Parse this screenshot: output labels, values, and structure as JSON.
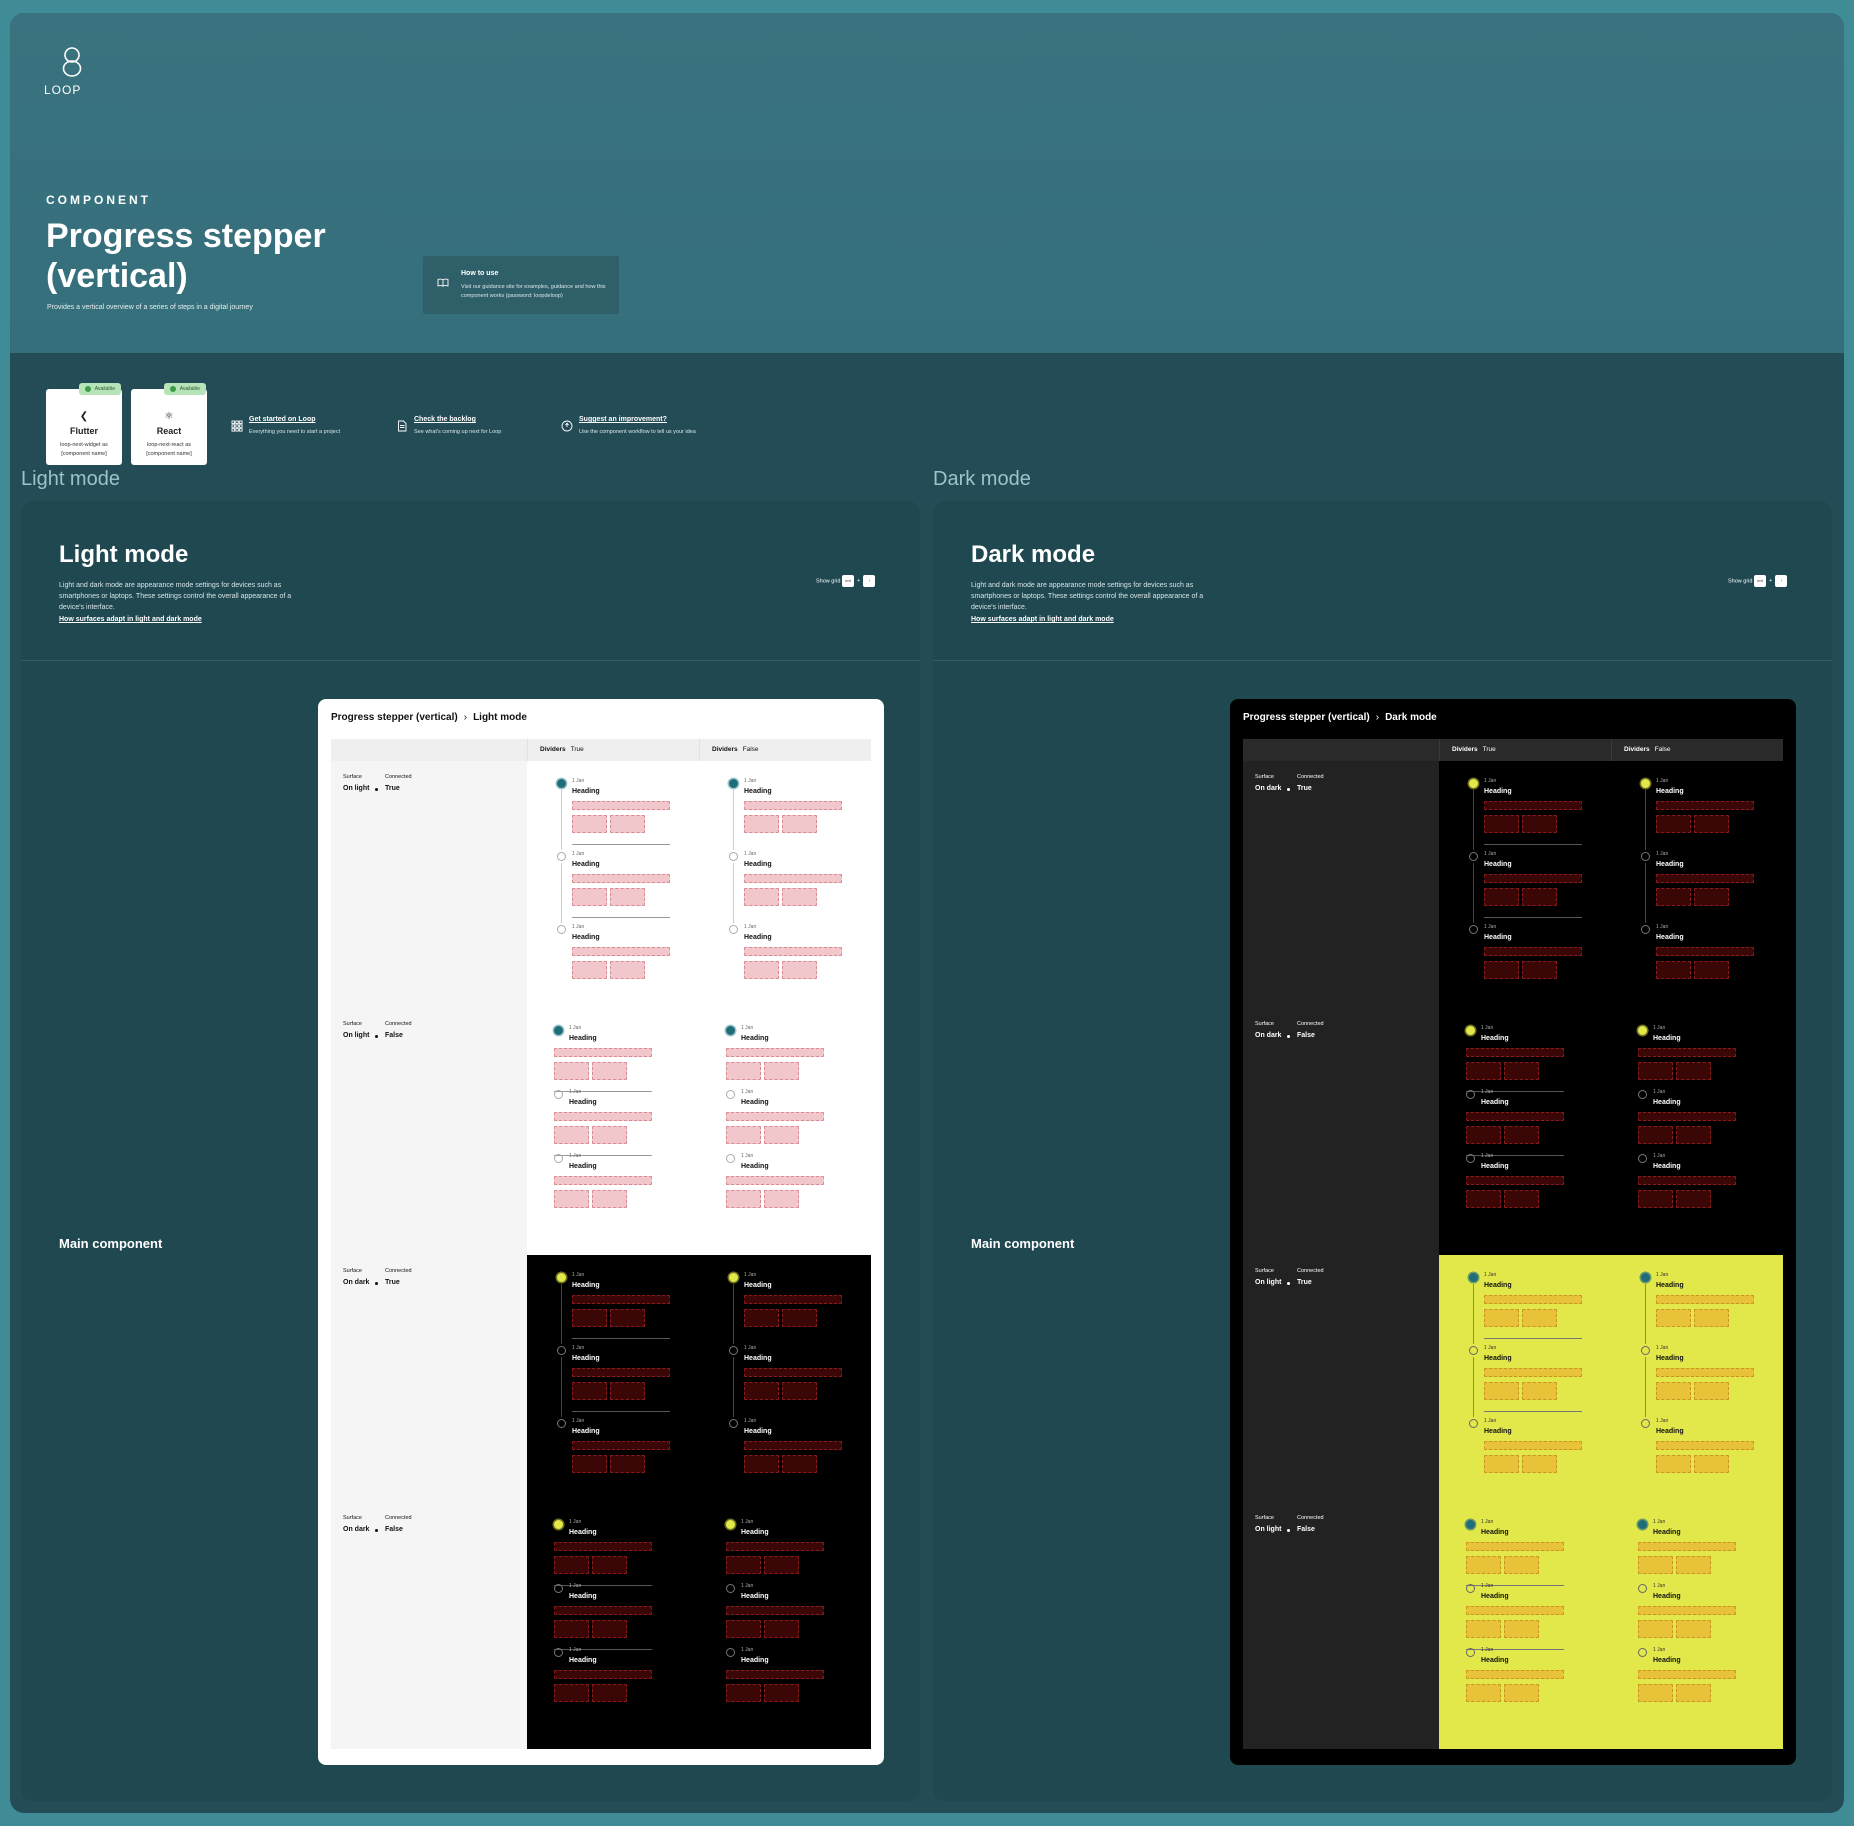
{
  "brand": {
    "wordmark": "LOOP"
  },
  "hero": {
    "kicker": "COMPONENT",
    "title": "Progress stepper (vertical)",
    "subtitle": "Provides a vertical overview of a series of steps in a digital journey",
    "howto": {
      "title": "How to use",
      "desc": "Visit our guidance site for examples, guidance and how this component works (password: loopdeloop)",
      "icon": "book-icon"
    }
  },
  "packages": [
    {
      "name": "Flutter",
      "pkg": "loop-next-widget as [component name]",
      "badge": "Available",
      "glyph": "❮"
    },
    {
      "name": "React",
      "pkg": "loop-next-react as [component name]",
      "badge": "Available",
      "glyph": "⚛"
    }
  ],
  "links": [
    {
      "title": "Get started on Loop",
      "desc": "Everything you need to start a project",
      "icon": "grid-icon"
    },
    {
      "title": "Check the backlog",
      "desc": "See what's coming up next for Loop",
      "icon": "document-icon"
    },
    {
      "title": "Suggest an improvement?",
      "desc": "Use the component workflow to tell us your idea",
      "icon": "lightbulb-icon"
    }
  ],
  "sections": {
    "light_label": "Light mode",
    "dark_label": "Dark mode"
  },
  "panel": {
    "desc": "Light and dark mode are appearance mode settings for devices such as smartphones or laptops. These settings control the overall appearance of a device's interface.",
    "link": "How surfaces adapt in light and dark mode",
    "show_grid": "Show grid",
    "grid_a": "ent",
    "grid_b": "↑",
    "grid_plus": "+",
    "main_component": "Main component"
  },
  "panels": {
    "light": {
      "title": "Light mode",
      "crumb_root": "Progress stepper (vertical)",
      "crumb_leaf": "Light mode"
    },
    "dark": {
      "title": "Dark mode",
      "crumb_root": "Progress stepper (vertical)",
      "crumb_leaf": "Dark mode"
    }
  },
  "table": {
    "columns": [
      {
        "key": "Dividers",
        "value": "True"
      },
      {
        "key": "Dividers",
        "value": "False"
      }
    ],
    "prop_surface": "Surface",
    "prop_connected": "Connected",
    "light_rows": [
      {
        "surface": "On light",
        "connected": "True"
      },
      {
        "surface": "On light",
        "connected": "False"
      },
      {
        "surface": "On dark",
        "connected": "True"
      },
      {
        "surface": "On dark",
        "connected": "False"
      }
    ],
    "dark_rows": [
      {
        "surface": "On dark",
        "connected": "True"
      },
      {
        "surface": "On dark",
        "connected": "False"
      },
      {
        "surface": "On light",
        "connected": "True"
      },
      {
        "surface": "On light",
        "connected": "False"
      }
    ],
    "step": {
      "date": "1 Jan",
      "heading": "Heading"
    }
  },
  "colors": {
    "frame": "#244c56",
    "hero": "#3a737f",
    "accent_teal": "#1f6d78",
    "accent_yellow": "#e2e84a",
    "placeholder_light": "#f2c7cc",
    "placeholder_dark": "#3a0606",
    "placeholder_yellow": "#e8c33a"
  }
}
